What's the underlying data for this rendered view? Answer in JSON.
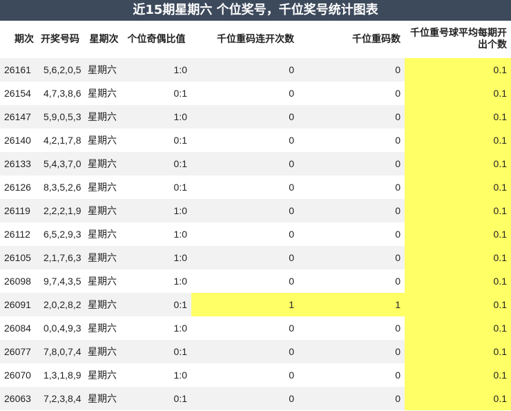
{
  "title": "近15期星期六 个位奖号，千位奖号统计图表",
  "highlight_color": "#ffff66",
  "header_color": "#3d4a5c",
  "columns": [
    "期次",
    "开奖号码",
    "星期次",
    "个位奇偶比值",
    "千位重码连开次数",
    "千位重码数",
    "千位重号球平均每期开出个数"
  ],
  "rows": [
    {
      "period": "26161",
      "numbers": "5,6,2,0,5",
      "weekday": "星期六",
      "ratio": "1:0",
      "repeat_streak": "0",
      "repeat_count": "0",
      "avg": "0.1"
    },
    {
      "period": "26154",
      "numbers": "4,7,3,8,6",
      "weekday": "星期六",
      "ratio": "0:1",
      "repeat_streak": "0",
      "repeat_count": "0",
      "avg": "0.1"
    },
    {
      "period": "26147",
      "numbers": "5,9,0,5,3",
      "weekday": "星期六",
      "ratio": "1:0",
      "repeat_streak": "0",
      "repeat_count": "0",
      "avg": "0.1"
    },
    {
      "period": "26140",
      "numbers": "4,2,1,7,8",
      "weekday": "星期六",
      "ratio": "0:1",
      "repeat_streak": "0",
      "repeat_count": "0",
      "avg": "0.1"
    },
    {
      "period": "26133",
      "numbers": "5,4,3,7,0",
      "weekday": "星期六",
      "ratio": "0:1",
      "repeat_streak": "0",
      "repeat_count": "0",
      "avg": "0.1"
    },
    {
      "period": "26126",
      "numbers": "8,3,5,2,6",
      "weekday": "星期六",
      "ratio": "0:1",
      "repeat_streak": "0",
      "repeat_count": "0",
      "avg": "0.1"
    },
    {
      "period": "26119",
      "numbers": "2,2,2,1,9",
      "weekday": "星期六",
      "ratio": "1:0",
      "repeat_streak": "0",
      "repeat_count": "0",
      "avg": "0.1"
    },
    {
      "period": "26112",
      "numbers": "6,5,2,9,3",
      "weekday": "星期六",
      "ratio": "1:0",
      "repeat_streak": "0",
      "repeat_count": "0",
      "avg": "0.1"
    },
    {
      "period": "26105",
      "numbers": "2,1,7,6,3",
      "weekday": "星期六",
      "ratio": "1:0",
      "repeat_streak": "0",
      "repeat_count": "0",
      "avg": "0.1"
    },
    {
      "period": "26098",
      "numbers": "9,7,4,3,5",
      "weekday": "星期六",
      "ratio": "1:0",
      "repeat_streak": "0",
      "repeat_count": "0",
      "avg": "0.1"
    },
    {
      "period": "26091",
      "numbers": "2,0,2,8,2",
      "weekday": "星期六",
      "ratio": "0:1",
      "repeat_streak": "1",
      "repeat_count": "1",
      "avg": "0.1",
      "highlight_repeat": true
    },
    {
      "period": "26084",
      "numbers": "0,0,4,9,3",
      "weekday": "星期六",
      "ratio": "1:0",
      "repeat_streak": "0",
      "repeat_count": "0",
      "avg": "0.1"
    },
    {
      "period": "26077",
      "numbers": "7,8,0,7,4",
      "weekday": "星期六",
      "ratio": "0:1",
      "repeat_streak": "0",
      "repeat_count": "0",
      "avg": "0.1"
    },
    {
      "period": "26070",
      "numbers": "1,3,1,8,9",
      "weekday": "星期六",
      "ratio": "1:0",
      "repeat_streak": "0",
      "repeat_count": "0",
      "avg": "0.1"
    },
    {
      "period": "26063",
      "numbers": "7,2,3,8,4",
      "weekday": "星期六",
      "ratio": "0:1",
      "repeat_streak": "0",
      "repeat_count": "0",
      "avg": "0.1"
    }
  ]
}
